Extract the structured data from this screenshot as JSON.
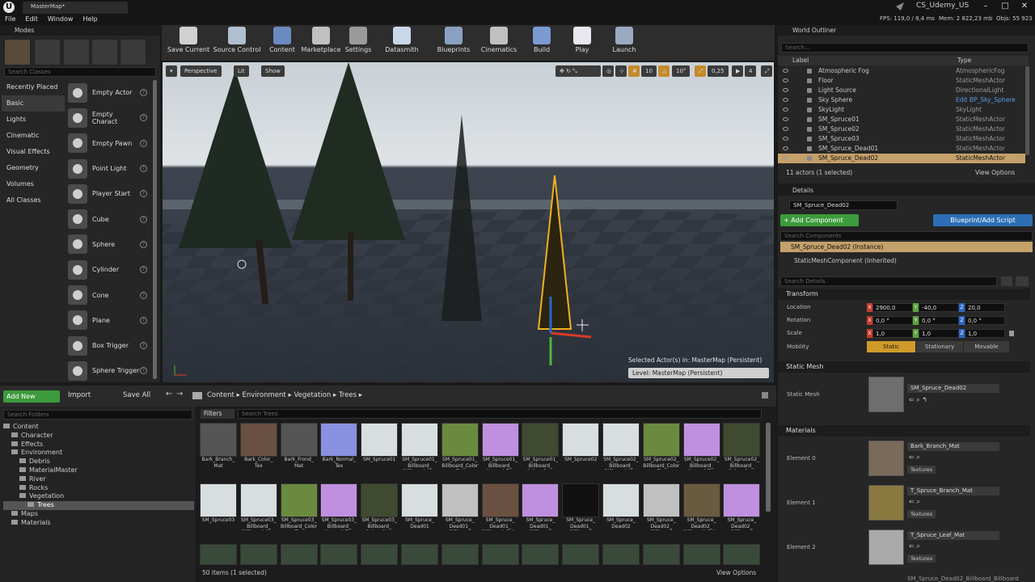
{
  "window": {
    "tab": "MasterMap*",
    "project": "CS_Udemy_US",
    "menu": [
      "File",
      "Edit",
      "Window",
      "Help"
    ],
    "stats": {
      "fps": "FPS: 119,0 / 8,4 ms",
      "mem": "Mem: 2 822,23 mb",
      "objs": "Objs: 55 923"
    }
  },
  "modes": {
    "title": "Modes",
    "search_placeholder": "Search Classes",
    "categories": [
      "Recently Placed",
      "Basic",
      "Lights",
      "Cinematic",
      "Visual Effects",
      "Geometry",
      "Volumes",
      "All Classes"
    ],
    "selected_category": "Basic",
    "items": [
      "Empty Actor",
      "Empty Charact",
      "Empty Pawn",
      "Point Light",
      "Player Start",
      "Cube",
      "Sphere",
      "Cylinder",
      "Cone",
      "Plane",
      "Box Trigger",
      "Sphere Trigger"
    ]
  },
  "toolbar": [
    "Save Current",
    "Source Control",
    "Content",
    "Marketplace",
    "Settings",
    "Datasmith",
    "Blueprints",
    "Cinematics",
    "Build",
    "Play",
    "Launch"
  ],
  "viewport": {
    "perspective": "Perspective",
    "lit": "Lit",
    "show": "Show",
    "snap": {
      "grid": "10",
      "rot": "10°",
      "scale": "0,25",
      "cam": "4"
    },
    "selected_info": "Selected Actor(s) in:  MasterMap (Persistent)",
    "level": "Level:  MasterMap (Persistent)"
  },
  "outliner": {
    "title": "World Outliner",
    "search_placeholder": "Search...",
    "col_label": "Label",
    "col_type": "Type",
    "rows": [
      {
        "label": "Atmospheric Fog",
        "type": "AtmosphericFog"
      },
      {
        "label": "Floor",
        "type": "StaticMeshActor"
      },
      {
        "label": "Light Source",
        "type": "DirectionalLight"
      },
      {
        "label": "Sky Sphere",
        "type": "Edit BP_Sky_Sphere"
      },
      {
        "label": "SkyLight",
        "type": "SkyLight"
      },
      {
        "label": "SM_Spruce01",
        "type": "StaticMeshActor"
      },
      {
        "label": "SM_Spruce02",
        "type": "StaticMeshActor"
      },
      {
        "label": "SM_Spruce03",
        "type": "StaticMeshActor"
      },
      {
        "label": "SM_Spruce_Dead01",
        "type": "StaticMeshActor"
      },
      {
        "label": "SM_Spruce_Dead02",
        "type": "StaticMeshActor"
      }
    ],
    "footer": "11 actors (1 selected)",
    "view_options": "View Options"
  },
  "details": {
    "title": "Details",
    "name": "SM_Spruce_Dead02",
    "add_component": "+ Add Component",
    "blueprint": "Blueprint/Add Script",
    "search_components": "Search Components",
    "instance": "SM_Spruce_Dead02 (Instance)",
    "component": "StaticMeshComponent (Inherited)",
    "search_details": "Search Details",
    "transform": {
      "title": "Transform",
      "location": {
        "label": "Location",
        "x": "2900,0",
        "y": "-40,0",
        "z": "20,0"
      },
      "rotation": {
        "label": "Rotation",
        "x": "0,0 °",
        "y": "0,0 °",
        "z": "0,0 °"
      },
      "scale": {
        "label": "Scale",
        "x": "1,0",
        "y": "1,0",
        "z": "1,0"
      },
      "mobility": {
        "label": "Mobility",
        "options": [
          "Static",
          "Stationary",
          "Movable"
        ]
      }
    },
    "static_mesh": {
      "title": "Static Mesh",
      "label": "Static Mesh",
      "value": "SM_Spruce_Dead02"
    },
    "materials": {
      "title": "Materials",
      "textures": "Textures",
      "elements": [
        {
          "label": "Element 0",
          "value": "Bark_Branch_Mat"
        },
        {
          "label": "Element 1",
          "value": "T_Spruce_Branch_Mat"
        },
        {
          "label": "Element 2",
          "value": "T_Spruce_Leaf_Mat"
        }
      ],
      "next": "SM_Spruce_Dead02_Billboard_Billboard"
    }
  },
  "content": {
    "add_new": "Add New",
    "import": "Import",
    "save_all": "Save All",
    "breadcrumb": [
      "Content",
      "Environment",
      "Vegetation",
      "Trees"
    ],
    "search_folders": "Search Folders",
    "filters": "Filters",
    "search_assets": "Search Trees",
    "folders": [
      {
        "name": "Content",
        "level": 0
      },
      {
        "name": "Character",
        "level": 1
      },
      {
        "name": "Effects",
        "level": 1
      },
      {
        "name": "Environment",
        "level": 1
      },
      {
        "name": "Debris",
        "level": 2
      },
      {
        "name": "MaterialMaster",
        "level": 2
      },
      {
        "name": "River",
        "level": 2
      },
      {
        "name": "Rocks",
        "level": 2
      },
      {
        "name": "Vegetation",
        "level": 2
      },
      {
        "name": "Trees",
        "level": 3
      },
      {
        "name": "Maps",
        "level": 1
      },
      {
        "name": "Materials",
        "level": 1
      }
    ],
    "assets_row1": [
      "Bark_Branch_ Mat",
      "Bark_Color_ Tex",
      "Bark_Frond_ Mat",
      "Bark_Normal_ Tex",
      "SM_Spruce01",
      "SM_Spruce01_ Billboard_ Billboard_Mat",
      "SM_Spruce01_ Billboard_Color Tex",
      "SM_Spruce01_ Billboard_ Normal_Tex",
      "SM_Spruce01_ Billboard_ Subsurface",
      "SM_Spruce02",
      "SM_Spruce02_ Billboard_ Billboard_Mat",
      "SM_Spruce02_ Billboard_Color Tex",
      "SM_Spruce02_ Billboard_ Normal_Tex",
      "SM_Spruce02_ Billboard_ Subsurface"
    ],
    "assets_row2": [
      "SM_Spruce03",
      "SM_Spruce03_ Billboard_ Billboard_Mat",
      "SM_Spruce03_ Billboard_Color Tex",
      "SM_Spruce03_ Billboard_ Normal_Tex",
      "SM_Spruce03_ Billboard_ Subsurface",
      "SM_Spruce_ Dead01",
      "SM_Spruce_ Dead01_ Billboard",
      "SM_Spruce_ Dead01_ Billboard_Color",
      "SM_Spruce_ Dead01_ Billboard",
      "SM_Spruce_ Dead01_ Billboard",
      "SM_Spruce_ Dead02",
      "SM_Spruce_ Dead02_ Billboard",
      "SM_Spruce_ Dead02_ Billboard_Color",
      "SM_Spruce_ Dead02_ Billboard"
    ],
    "footer": "50 items (1 selected)",
    "view_options": "View Options"
  },
  "colors": {
    "accent_selected": "#c4a06a",
    "green": "#3c9b3c",
    "blue": "#2c6fb5",
    "x": "#c73a2a",
    "y": "#5aa23a",
    "z": "#2a66c7"
  }
}
